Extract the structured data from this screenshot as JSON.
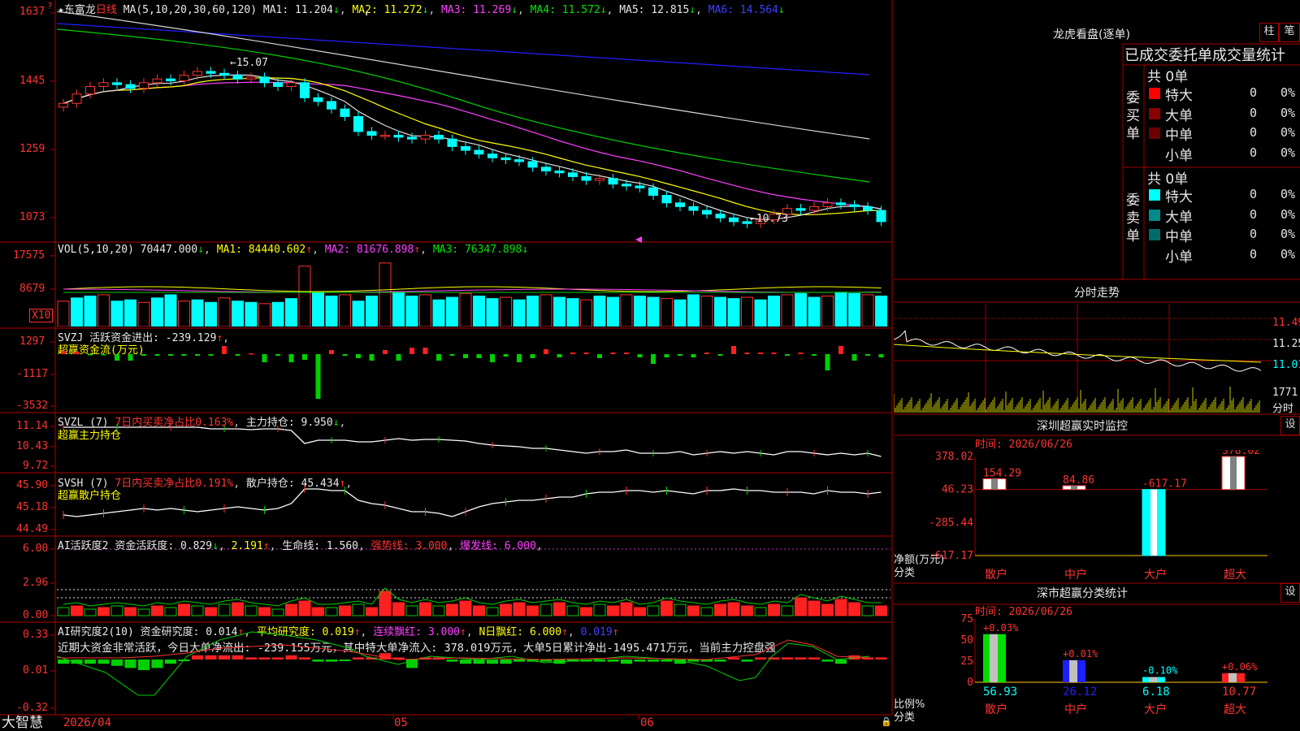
{
  "main": {
    "ytick_labels": [
      "1637",
      "1445",
      "1259",
      "1073"
    ],
    "header": {
      "star": "★",
      "stock": "东富龙",
      "period": "日线",
      "ma_label": "MA(5,10,20,30,60,120)",
      "ma1": "MA1: 11.204",
      "ma2": "MA2: 11.272",
      "ma3": "MA3: 11.269",
      "ma4": "MA4: 11.572",
      "ma5": "MA5: 12.815",
      "ma6": "MA6: 14.564"
    },
    "high_mark": "←15.07",
    "low_mark": "←10.73"
  },
  "vol": {
    "ytick_labels": [
      "17575",
      "8679"
    ],
    "unit_badge": "X10",
    "header": {
      "name": "VOL(5,10,20)",
      "v": "70447.000",
      "ma1": "MA1: 84440.602",
      "ma2": "MA2: 81676.898",
      "ma3": "MA3: 76347.898"
    }
  },
  "svzj": {
    "ytick_labels": [
      "1297",
      "-1117",
      "-3532"
    ],
    "header": {
      "name": "SVZJ",
      "label": "活跃资金进出: -239.129",
      "sub": "超赢资金流(万元)"
    }
  },
  "svzl": {
    "ytick_labels": [
      "11.14",
      "10.43",
      "9.72"
    ],
    "header": {
      "name": "SVZL (7)",
      "ratio": "7日内买卖净占比0.163%",
      "hold": "主力持仓: 9.950",
      "sub": "超赢主力持仓"
    }
  },
  "svsh": {
    "ytick_labels": [
      "45.90",
      "45.18",
      "44.49"
    ],
    "header": {
      "name": "SVSH (7)",
      "ratio": "7日内买卖净占比0.191%",
      "hold": "散户持仓: 45.434",
      "sub": "超赢散户持仓"
    }
  },
  "ai1": {
    "ytick_labels": [
      "6.00",
      "2.96",
      "0.00"
    ],
    "header": {
      "name": "AI活跃度2",
      "a": "资金活跃度: 0.829",
      "b": "2.191",
      "c": "生命线: 1.560",
      "d": "强势线: 3.000",
      "e": "爆发线: 6.000"
    }
  },
  "ai2": {
    "ytick_labels": [
      "0.33",
      "0.01",
      "-0.32"
    ],
    "header": {
      "name": "AI研究度2(10)",
      "a": "资金研究度: 0.014",
      "b": "平均研究度: 0.019",
      "c": "连续飘红: 3.000",
      "d": "N日飘红: 6.000",
      "e": "0.019"
    },
    "summary": "近期大资金非常活跃，今日大单净流出: -239.155万元，其中特大单净流入: 378.019万元，大单5日累计净出-1495.471万元，当前主力控盘强"
  },
  "bottom_axis": {
    "brand": "大智慧",
    "start_date": "2026/04",
    "m05": "05",
    "m06": "06"
  },
  "lhb": {
    "title": "龙虎看盘(逐单)",
    "btn_bar": "柱",
    "btn_pen": "笔",
    "tabs_text": "已成交委托单成交量统计",
    "buy": {
      "side_label": "委买单",
      "total": "共 0单",
      "rows": [
        {
          "label": "特大",
          "count": "0",
          "pct": "0%",
          "color": "#ff0000"
        },
        {
          "label": "大单",
          "count": "0",
          "pct": "0%",
          "color": "#8b0000"
        },
        {
          "label": "中单",
          "count": "0",
          "pct": "0%",
          "color": "#6b0000"
        },
        {
          "label": "小单",
          "count": "0",
          "pct": "0%",
          "color": "#000000"
        }
      ]
    },
    "sell": {
      "side_label": "委卖单",
      "total": "共 0单",
      "rows": [
        {
          "label": "特大",
          "count": "0",
          "pct": "0%",
          "color": "#00ffff"
        },
        {
          "label": "大单",
          "count": "0",
          "pct": "0%",
          "color": "#008b8b"
        },
        {
          "label": "中单",
          "count": "0",
          "pct": "0%",
          "color": "#006b6b"
        },
        {
          "label": "小单",
          "count": "0",
          "pct": "0%",
          "color": "#000000"
        }
      ]
    }
  },
  "intraday": {
    "title": "分时走势",
    "ytick_labels": [
      "11.49",
      "11.25",
      "11.01",
      "1771"
    ],
    "time_label": "分时"
  },
  "monitor": {
    "title": "深圳超赢实时监控",
    "set_btn": "设",
    "time": "时间: 2026/06/26",
    "ytick_labels": [
      "378.02",
      "46.23",
      "-285.44",
      "-617.17"
    ],
    "axis_unit": "净额(万元)",
    "axis_cat": "分类",
    "chart_data": {
      "type": "bar",
      "title": "深圳超赢实时监控",
      "categories": [
        "散户",
        "中户",
        "大户",
        "超大"
      ],
      "values": [
        154.29,
        84.86,
        -617.17,
        378.02
      ],
      "value_labels": [
        "154.29",
        "84.86",
        "-617.17",
        "378.02"
      ],
      "ylim": [
        -617.17,
        378.02
      ],
      "ylabel": "净额(万元)",
      "xlabel": "分类"
    }
  },
  "classify": {
    "title": "深市超赢分类统计",
    "set_btn": "设",
    "time": "时间: 2026/06/26",
    "ytick_labels": [
      "75",
      "50",
      "25",
      "0"
    ],
    "axis_unit": "比例%",
    "axis_cat": "分类",
    "chart_data": {
      "type": "bar",
      "title": "深市超赢分类统计",
      "categories": [
        "散户",
        "中户",
        "大户",
        "超大"
      ],
      "values": [
        56.93,
        26.12,
        6.18,
        10.77
      ],
      "value_labels": [
        "56.93",
        "26.12",
        "6.18",
        "10.77"
      ],
      "change_labels": [
        "+0.03%",
        "+0.01%",
        "-0.10%",
        "+0.06%"
      ],
      "ylim": [
        0,
        75
      ],
      "ylabel": "比例%",
      "xlabel": "分类"
    }
  }
}
